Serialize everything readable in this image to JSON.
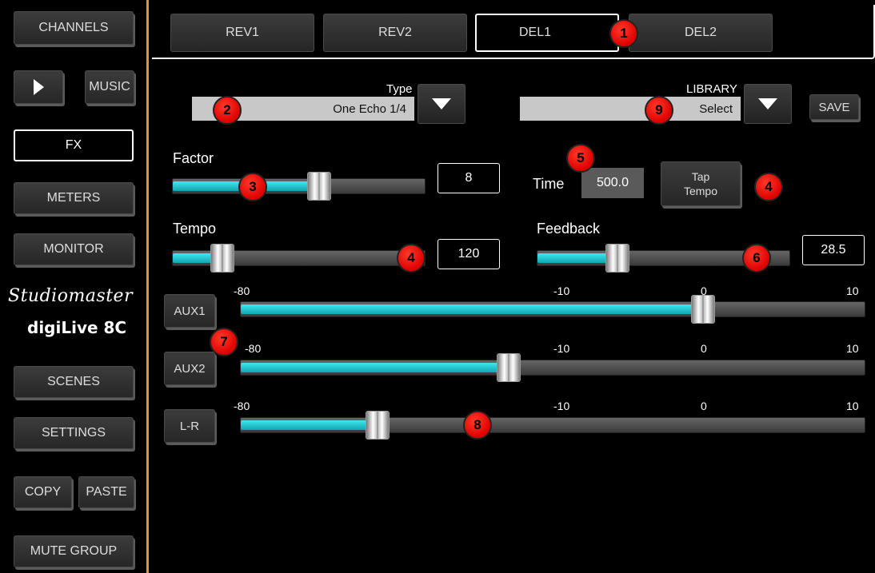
{
  "sidebar": {
    "channels": "CHANNELS",
    "play_icon": "play-icon",
    "music": "MUSIC",
    "fx": "FX",
    "meters": "METERS",
    "monitor": "MONITOR",
    "logo_brand": "Studiomaster",
    "logo_product": "digiLive 8C",
    "scenes": "SCENES",
    "settings": "SETTINGS",
    "copy": "COPY",
    "paste": "PASTE",
    "mute_group": "MUTE GROUP"
  },
  "tabs": [
    {
      "label": "REV1",
      "active": false
    },
    {
      "label": "REV2",
      "active": false
    },
    {
      "label": "DEL1",
      "active": true
    },
    {
      "label": "DEL2",
      "active": false
    }
  ],
  "type_select": {
    "label": "Type",
    "value": "One Echo 1/4"
  },
  "library": {
    "label": "LIBRARY",
    "value": "Select",
    "save": "SAVE"
  },
  "factor": {
    "label": "Factor",
    "value": "8",
    "level": 0.58
  },
  "tempo": {
    "label": "Tempo",
    "value": "120",
    "level": 0.2
  },
  "time": {
    "label": "Time",
    "value": "500.0"
  },
  "tap_tempo": {
    "line1": "Tap",
    "line2": "Tempo"
  },
  "feedback": {
    "label": "Feedback",
    "value": "28.5",
    "level": 0.32
  },
  "scale_ticks": [
    "-80",
    "-10",
    "0",
    "10"
  ],
  "aux": [
    {
      "label": "AUX1",
      "level": 0.74
    },
    {
      "label": "AUX2",
      "level": 0.43
    },
    {
      "label": "L-R",
      "level": 0.22
    }
  ],
  "badges": [
    "1",
    "2",
    "3",
    "4",
    "4",
    "5",
    "6",
    "7",
    "8",
    "9"
  ],
  "colors": {
    "accent": "#e8902a",
    "fill": "#1ec8d2",
    "badge": "#e8170e"
  }
}
